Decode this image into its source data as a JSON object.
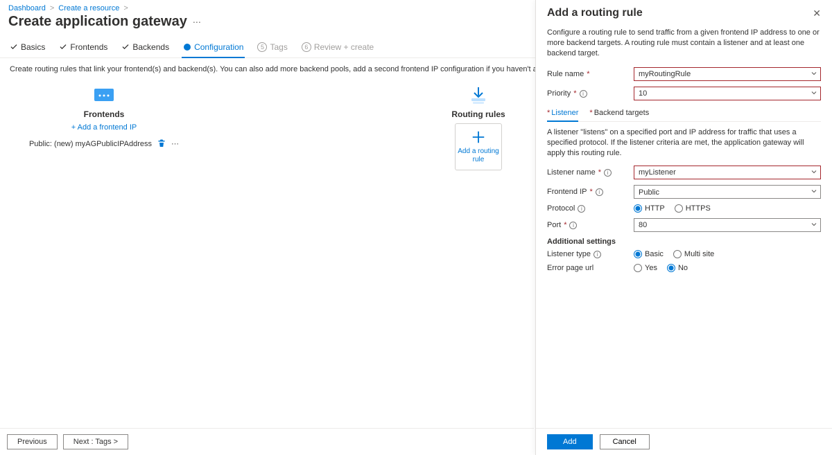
{
  "breadcrumb": {
    "items": [
      "Dashboard",
      "Create a resource"
    ],
    "sep": ">"
  },
  "page": {
    "title": "Create application gateway",
    "hint": "Create routing rules that link your frontend(s) and backend(s). You can also add more backend pools, add a second frontend IP configuration if you haven't already, or edit previous configurations."
  },
  "tabs": {
    "basics": "Basics",
    "frontends": "Frontends",
    "backends": "Backends",
    "configuration": "Configuration",
    "tags_num": "5",
    "tags": "Tags",
    "review_num": "6",
    "review": "Review + create"
  },
  "canvas": {
    "frontends_title": "Frontends",
    "add_frontend": "+ Add a frontend IP",
    "frontend_item": "Public: (new) myAGPublicIPAddress",
    "routing_title": "Routing rules",
    "add_rule_tile": "Add a routing rule"
  },
  "footer": {
    "prev": "Previous",
    "next": "Next : Tags >"
  },
  "panel": {
    "title": "Add a routing rule",
    "desc": "Configure a routing rule to send traffic from a given frontend IP address to one or more backend targets. A routing rule must contain a listener and at least one backend target.",
    "rule_name_label": "Rule name",
    "rule_name_value": "myRoutingRule",
    "priority_label": "Priority",
    "priority_value": "10",
    "subtabs": {
      "listener": "Listener",
      "backend": "Backend targets"
    },
    "listener_hint": "A listener \"listens\" on a specified port and IP address for traffic that uses a specified protocol. If the listener criteria are met, the application gateway will apply this routing rule.",
    "listener_name_label": "Listener name",
    "listener_name_value": "myListener",
    "frontend_ip_label": "Frontend IP",
    "frontend_ip_value": "Public",
    "protocol_label": "Protocol",
    "protocol_http": "HTTP",
    "protocol_https": "HTTPS",
    "port_label": "Port",
    "port_value": "80",
    "additional": "Additional settings",
    "listener_type_label": "Listener type",
    "listener_type_basic": "Basic",
    "listener_type_multi": "Multi site",
    "error_page_label": "Error page url",
    "error_yes": "Yes",
    "error_no": "No",
    "add": "Add",
    "cancel": "Cancel"
  }
}
